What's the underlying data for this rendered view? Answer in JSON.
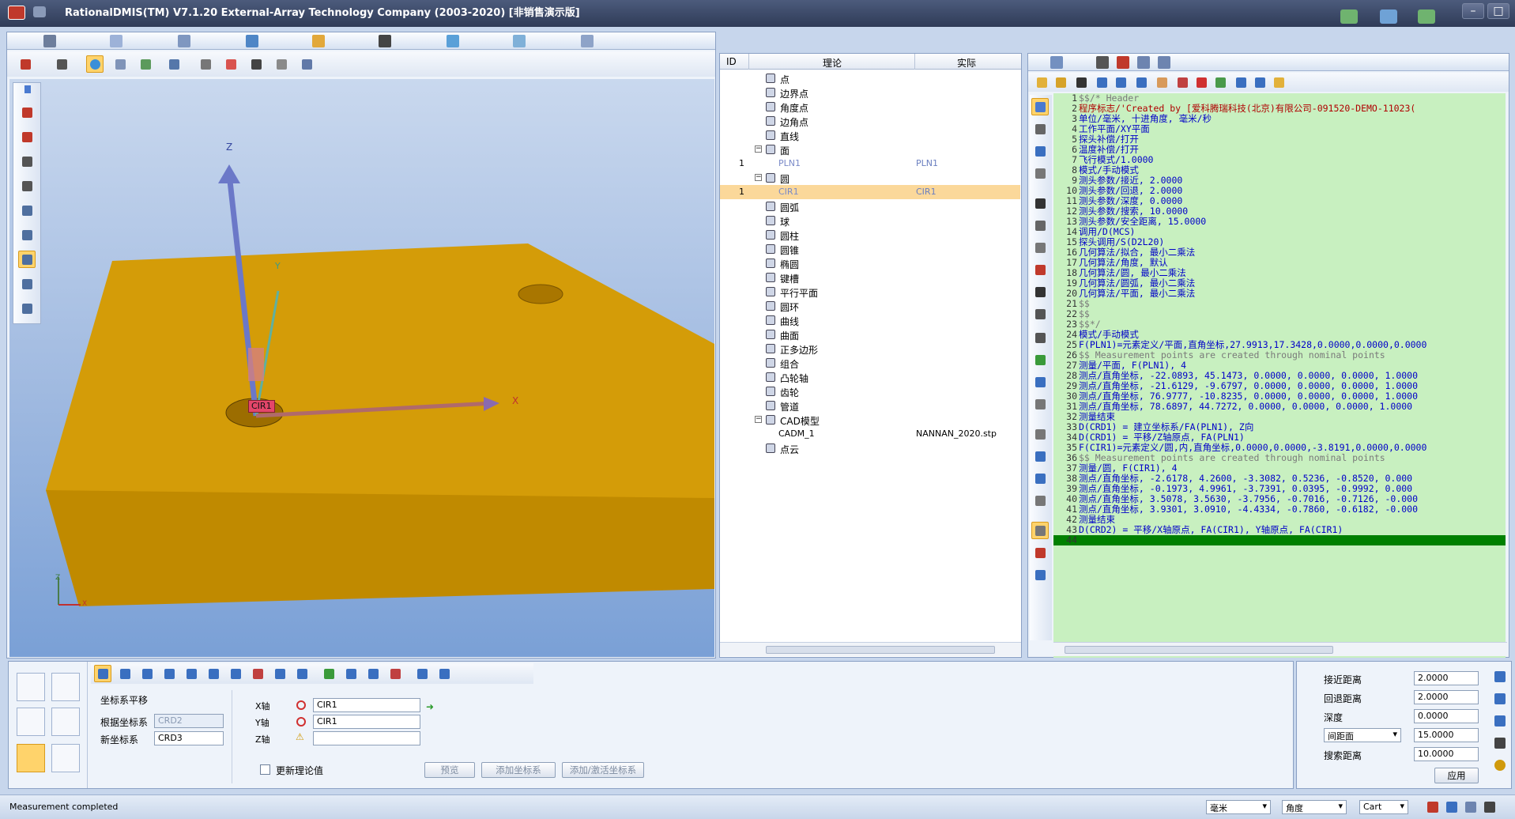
{
  "titlebar": {
    "title": "RationalDMIS(TM) V7.1.20    External-Array Technology Company (2003-2020) [非销售演示版]"
  },
  "viewport": {
    "axis_labels": {
      "z": "Z",
      "y": "Y",
      "x": "X"
    },
    "feature_tag": "CIR1",
    "mini_axis": {
      "y": "Y",
      "z": "Z",
      "x": "X"
    }
  },
  "tree": {
    "headers": {
      "id": "ID",
      "nominal": "理论",
      "actual": "实际"
    },
    "rows": [
      {
        "indent": 1,
        "label": "点",
        "id": "",
        "actual": ""
      },
      {
        "indent": 1,
        "label": "边界点",
        "id": "",
        "actual": ""
      },
      {
        "indent": 1,
        "label": "角度点",
        "id": "",
        "actual": ""
      },
      {
        "indent": 1,
        "label": "边角点",
        "id": "",
        "actual": ""
      },
      {
        "indent": 1,
        "label": "直线",
        "id": "",
        "actual": ""
      },
      {
        "indent": 1,
        "label": "面",
        "id": "",
        "actual": "",
        "expanded": true
      },
      {
        "indent": 2,
        "label": "PLN1",
        "id": "1",
        "actual": "PLN1"
      },
      {
        "indent": 1,
        "label": "圆",
        "id": "",
        "actual": "",
        "expanded": true
      },
      {
        "indent": 2,
        "label": "CIR1",
        "id": "1",
        "actual": "CIR1",
        "selected": true
      },
      {
        "indent": 1,
        "label": "圆弧",
        "id": "",
        "actual": ""
      },
      {
        "indent": 1,
        "label": "球",
        "id": "",
        "actual": ""
      },
      {
        "indent": 1,
        "label": "圆柱",
        "id": "",
        "actual": ""
      },
      {
        "indent": 1,
        "label": "圆锥",
        "id": "",
        "actual": ""
      },
      {
        "indent": 1,
        "label": "椭圆",
        "id": "",
        "actual": ""
      },
      {
        "indent": 1,
        "label": "键槽",
        "id": "",
        "actual": ""
      },
      {
        "indent": 1,
        "label": "平行平面",
        "id": "",
        "actual": ""
      },
      {
        "indent": 1,
        "label": "圆环",
        "id": "",
        "actual": ""
      },
      {
        "indent": 1,
        "label": "曲线",
        "id": "",
        "actual": ""
      },
      {
        "indent": 1,
        "label": "曲面",
        "id": "",
        "actual": ""
      },
      {
        "indent": 1,
        "label": "正多边形",
        "id": "",
        "actual": ""
      },
      {
        "indent": 1,
        "label": "组合",
        "id": "",
        "actual": ""
      },
      {
        "indent": 1,
        "label": "凸轮轴",
        "id": "",
        "actual": ""
      },
      {
        "indent": 1,
        "label": "齿轮",
        "id": "",
        "actual": ""
      },
      {
        "indent": 1,
        "label": "管道",
        "id": "",
        "actual": ""
      },
      {
        "indent": 1,
        "label": "CAD模型",
        "id": "",
        "actual": "",
        "expanded": true
      },
      {
        "indent": 2,
        "label": "CADM_1",
        "id": "",
        "actual": "NANNAN_2020.stp"
      },
      {
        "indent": 1,
        "label": "点云",
        "id": "",
        "actual": ""
      }
    ]
  },
  "code": {
    "lines": [
      {
        "n": "1",
        "t": "$$/*  Header",
        "c": "#7a7a7a"
      },
      {
        "n": "2",
        "t": "程序标志/'Created by [爱科腾瑞科技(北京)有限公司-091520-DEMO-11023(",
        "c": "#b00000"
      },
      {
        "n": "3",
        "t": "单位/毫米, 十进角度, 毫米/秒",
        "c": "#0000c8"
      },
      {
        "n": "4",
        "t": "工作平面/XY平面",
        "c": "#0000c8"
      },
      {
        "n": "5",
        "t": "探头补偿/打开",
        "c": "#0000c8"
      },
      {
        "n": "6",
        "t": "温度补偿/打开",
        "c": "#0000c8"
      },
      {
        "n": "7",
        "t": "飞行模式/1.0000",
        "c": "#0000c8"
      },
      {
        "n": "8",
        "t": "模式/手动模式",
        "c": "#0000c8"
      },
      {
        "n": "9",
        "t": "测头参数/接近, 2.0000",
        "c": "#0000c8"
      },
      {
        "n": "10",
        "t": "测头参数/回退, 2.0000",
        "c": "#0000c8"
      },
      {
        "n": "11",
        "t": "测头参数/深度, 0.0000",
        "c": "#0000c8"
      },
      {
        "n": "12",
        "t": "测头参数/搜索, 10.0000",
        "c": "#0000c8"
      },
      {
        "n": "13",
        "t": "测头参数/安全距离, 15.0000",
        "c": "#0000c8"
      },
      {
        "n": "14",
        "t": "调用/D(MCS)",
        "c": "#0000c8"
      },
      {
        "n": "15",
        "t": "探头调用/S(D2L20)",
        "c": "#0000c8"
      },
      {
        "n": "16",
        "t": "几何算法/拟合, 最小二乘法",
        "c": "#0000c8"
      },
      {
        "n": "17",
        "t": "几何算法/角度, 默认",
        "c": "#0000c8"
      },
      {
        "n": "18",
        "t": "几何算法/圆, 最小二乘法",
        "c": "#0000c8"
      },
      {
        "n": "19",
        "t": "几何算法/圆弧, 最小二乘法",
        "c": "#0000c8"
      },
      {
        "n": "20",
        "t": "几何算法/平面, 最小二乘法",
        "c": "#0000c8"
      },
      {
        "n": "21",
        "t": "$$",
        "c": "#7a7a7a"
      },
      {
        "n": "22",
        "t": "$$",
        "c": "#7a7a7a"
      },
      {
        "n": "23",
        "t": "$$*/",
        "c": "#7a7a7a"
      },
      {
        "n": "24",
        "t": "模式/手动模式",
        "c": "#0000c8"
      },
      {
        "n": "25",
        "t": "F(PLN1)=元素定义/平面,直角坐标,27.9913,17.3428,0.0000,0.0000,0.0000",
        "c": "#0000c8"
      },
      {
        "n": "26",
        "t": "$$ Measurement points are created through nominal points",
        "c": "#7a7a7a"
      },
      {
        "n": "27",
        "t": "测量/平面, F(PLN1), 4",
        "c": "#0000c8"
      },
      {
        "n": "28",
        "t": "  测点/直角坐标, -22.0893,  45.1473, 0.0000, 0.0000, 0.0000, 1.0000",
        "c": "#0000c8"
      },
      {
        "n": "29",
        "t": "  测点/直角坐标, -21.6129,  -9.6797, 0.0000, 0.0000, 0.0000, 1.0000",
        "c": "#0000c8"
      },
      {
        "n": "30",
        "t": "  测点/直角坐标,  76.9777, -10.8235, 0.0000, 0.0000, 0.0000, 1.0000",
        "c": "#0000c8"
      },
      {
        "n": "31",
        "t": "  测点/直角坐标,  78.6897,  44.7272, 0.0000, 0.0000, 0.0000, 1.0000",
        "c": "#0000c8"
      },
      {
        "n": "32",
        "t": "测量结束",
        "c": "#0000c8"
      },
      {
        "n": "33",
        "t": "D(CRD1) = 建立坐标系/FA(PLN1), Z向",
        "c": "#0000c8"
      },
      {
        "n": "34",
        "t": "D(CRD1) = 平移/Z轴原点, FA(PLN1)",
        "c": "#0000c8"
      },
      {
        "n": "35",
        "t": "F(CIR1)=元素定义/圆,内,直角坐标,0.0000,0.0000,-3.8191,0.0000,0.0000",
        "c": "#0000c8"
      },
      {
        "n": "36",
        "t": "$$ Measurement points are created through nominal points",
        "c": "#7a7a7a"
      },
      {
        "n": "37",
        "t": "测量/圆, F(CIR1), 4",
        "c": "#0000c8"
      },
      {
        "n": "38",
        "t": "  测点/直角坐标, -2.6178, 4.2600, -3.3082,  0.5236, -0.8520,  0.000",
        "c": "#0000c8"
      },
      {
        "n": "39",
        "t": "  测点/直角坐标, -0.1973, 4.9961, -3.7391,  0.0395, -0.9992,  0.000",
        "c": "#0000c8"
      },
      {
        "n": "40",
        "t": "  测点/直角坐标,  3.5078, 3.5630, -3.7956, -0.7016, -0.7126, -0.000",
        "c": "#0000c8"
      },
      {
        "n": "41",
        "t": "  测点/直角坐标,  3.9301, 3.0910, -4.4334, -0.7860, -0.6182, -0.000",
        "c": "#0000c8"
      },
      {
        "n": "42",
        "t": "测量结束",
        "c": "#0000c8"
      },
      {
        "n": "43",
        "t": "D(CRD2) = 平移/X轴原点, FA(CIR1), Y轴原点, FA(CIR1)",
        "c": "#0000c8"
      },
      {
        "n": "44",
        "t": "",
        "c": "#0000c8"
      }
    ]
  },
  "bottom": {
    "panel_title": "坐标系平移",
    "from_label": "根据坐标系",
    "from_value": "CRD2",
    "new_label": "新坐标系",
    "new_value": "CRD3",
    "x_label": "X轴",
    "x_value": "CIR1",
    "y_label": "Y轴",
    "y_value": "CIR1",
    "z_label": "Z轴",
    "z_value": "",
    "update_checkbox": "更新理论值",
    "preview_btn": "预览",
    "add_btn": "添加坐标系",
    "add_activate_btn": "添加/激活坐标系"
  },
  "probe_params": {
    "approach_label": "接近距离",
    "approach_value": "2.0000",
    "retract_label": "回退距离",
    "retract_value": "2.0000",
    "depth_label": "深度",
    "depth_value": "0.0000",
    "clearance_select": "间距面",
    "clearance_value": "15.0000",
    "search_label": "搜索距离",
    "search_value": "10.0000",
    "apply_btn": "应用"
  },
  "statusbar": {
    "message": "Measurement completed",
    "unit_select": "毫米",
    "angle_select": "角度",
    "coord_select": "Cart"
  },
  "colors": {
    "accent": "#ffd36b",
    "code_bg": "#c8f0c0",
    "selection_row": "#fbd89a",
    "current_line": "#008000",
    "part": "#d09a0c"
  }
}
